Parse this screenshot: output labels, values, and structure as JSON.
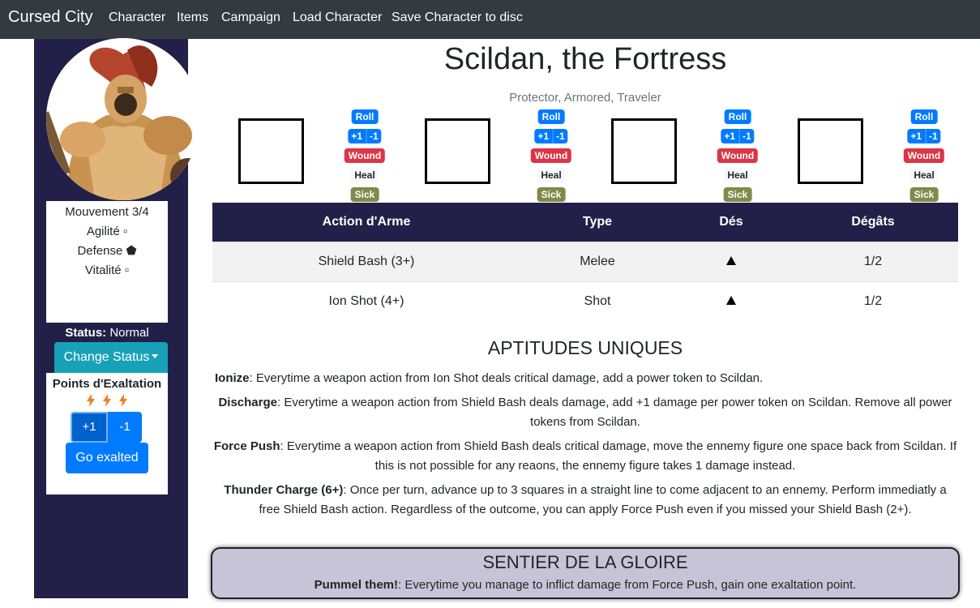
{
  "navbar": {
    "brand": "Cursed City",
    "links": [
      "Character",
      "Items",
      "Campaign",
      "Load Character",
      "Save Character to disc"
    ]
  },
  "sidebar": {
    "stats": [
      "Mouvement 3/4",
      "Agilité ▫",
      "Defense ⬟",
      "Vitalité ▫"
    ],
    "status_label": "Status:",
    "status_value": "Normal",
    "change_status": "Change Status",
    "exaltation_title": "Points d'Exaltation",
    "exaltation_bolts": 3,
    "plus_label": "+1",
    "minus_label": "-1",
    "go_exalted": "Go exalted"
  },
  "character": {
    "name": "Scildan, the Fortress",
    "keywords": "Protector, Armored, Traveler"
  },
  "wound_slots": {
    "roll": "Roll",
    "plus": "+1",
    "minus": "-1",
    "wound": "Wound",
    "heal": "Heal",
    "sick": "Sick"
  },
  "weapons": {
    "headers": [
      "Action d'Arme",
      "Type",
      "Dés",
      "Dégâts"
    ],
    "rows": [
      {
        "name": "Shield Bash (3+)",
        "type": "Melee",
        "damage": "1/2"
      },
      {
        "name": "Ion Shot (4+)",
        "type": "Shot",
        "damage": "1/2"
      }
    ]
  },
  "aptitudes": {
    "title": "APTITUDES UNIQUES",
    "items": [
      {
        "name": "Ionize",
        "text": ": Everytime a weapon action from Ion Shot deals critical damage, add a power token to Scildan."
      },
      {
        "name": "Discharge",
        "text": ": Everytime a weapon action from Shield Bash deals damage, add +1 damage per power token on Scildan. Remove all power tokens from Scildan."
      },
      {
        "name": "Force Push",
        "text": ": Everytime a weapon action from Shield Bash deals critical damage, move the ennemy figure one space back from Scildan. If this is not possible for any reaons, the ennemy figure takes 1 damage instead."
      },
      {
        "name": "Thunder Charge (6+)",
        "text": ": Once per turn, advance up to 3 squares in a straight line to come adjacent to an ennemy. Perform immediatly a free Shield Bash action. Regardless of the outcome, you can apply Force Push even if you missed your Shield Bash (2+)."
      }
    ]
  },
  "gloire": {
    "title": "SENTIER DE LA GLOIRE",
    "name": "Pummel them!",
    "text": ": Everytime you manage to inflict damage from Force Push, gain one exaltation point."
  },
  "colors": {
    "navbar": "#343a40",
    "sidebar": "#222049",
    "primary": "#007bff",
    "info": "#17a2b8",
    "danger": "#dc3545",
    "sick": "#808a4a",
    "gloire_bg": "#c8c4d8"
  }
}
